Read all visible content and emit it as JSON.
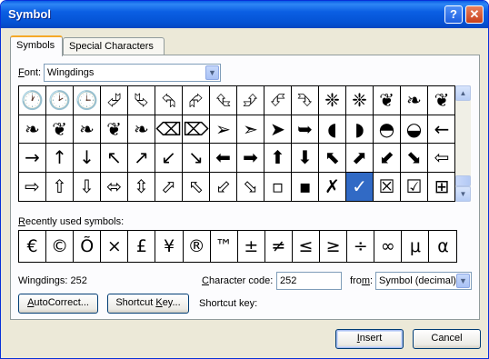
{
  "window": {
    "title": "Symbol",
    "help_label": "?",
    "close_label": "✕"
  },
  "tabs": [
    {
      "label": "Symbols",
      "active": true
    },
    {
      "label": "Special Characters",
      "active": false
    }
  ],
  "font": {
    "label_underlined": "F",
    "label_rest": "ont:",
    "value": "Wingdings"
  },
  "symbol_grid": [
    "🕐",
    "🕑",
    "🕒",
    "⮰",
    "⮱",
    "⮲",
    "⮳",
    "⮴",
    "⮵",
    "⮶",
    "⮷",
    "❈",
    "❈",
    "❦",
    "❧",
    "❦",
    "❧",
    "❦",
    "❧",
    "❦",
    "❧",
    "⌫",
    "⌦",
    "➢",
    "➣",
    "➤",
    "➥",
    "◖",
    "◗",
    "◓",
    "◒",
    "←",
    "→",
    "↑",
    "↓",
    "↖",
    "↗",
    "↙",
    "↘",
    "⬅",
    "➡",
    "⬆",
    "⬇",
    "⬉",
    "⬈",
    "⬋",
    "⬊",
    "⇦",
    "⇨",
    "⇧",
    "⇩",
    "⬄",
    "⇳",
    "⬀",
    "⬁",
    "⬃",
    "⬂",
    "▫",
    "▪",
    "✗",
    "✓",
    "☒",
    "☑",
    "⊞"
  ],
  "selected_index": 60,
  "recently_used_label": "Recently used symbols:",
  "recently_used_label_underline": "R",
  "recent_symbols": [
    "€",
    "©",
    "Õ",
    "×",
    "£",
    "¥",
    "®",
    "™",
    "±",
    "≠",
    "≤",
    "≥",
    "÷",
    "∞",
    "μ",
    "α"
  ],
  "char_name": "Wingdings: 252",
  "character_code": {
    "label_underlined": "C",
    "label_rest": "haracter code:",
    "value": "252"
  },
  "from": {
    "label_underlined": "m",
    "label_pre": "fro",
    "label_post": ":",
    "value": "Symbol (decimal)"
  },
  "buttons": {
    "autocorrect": "AutoCorrect...",
    "autocorrect_underline": "A",
    "shortcut_key": "Shortcut Key...",
    "shortcut_key_underline": "K",
    "insert": "Insert",
    "insert_underline": "I",
    "cancel": "Cancel"
  },
  "shortcut_key_label": "Shortcut key:",
  "colors": {
    "title_bar": "#0a5ee6",
    "selection": "#316ac5",
    "tab_accent": "#f5a928"
  }
}
